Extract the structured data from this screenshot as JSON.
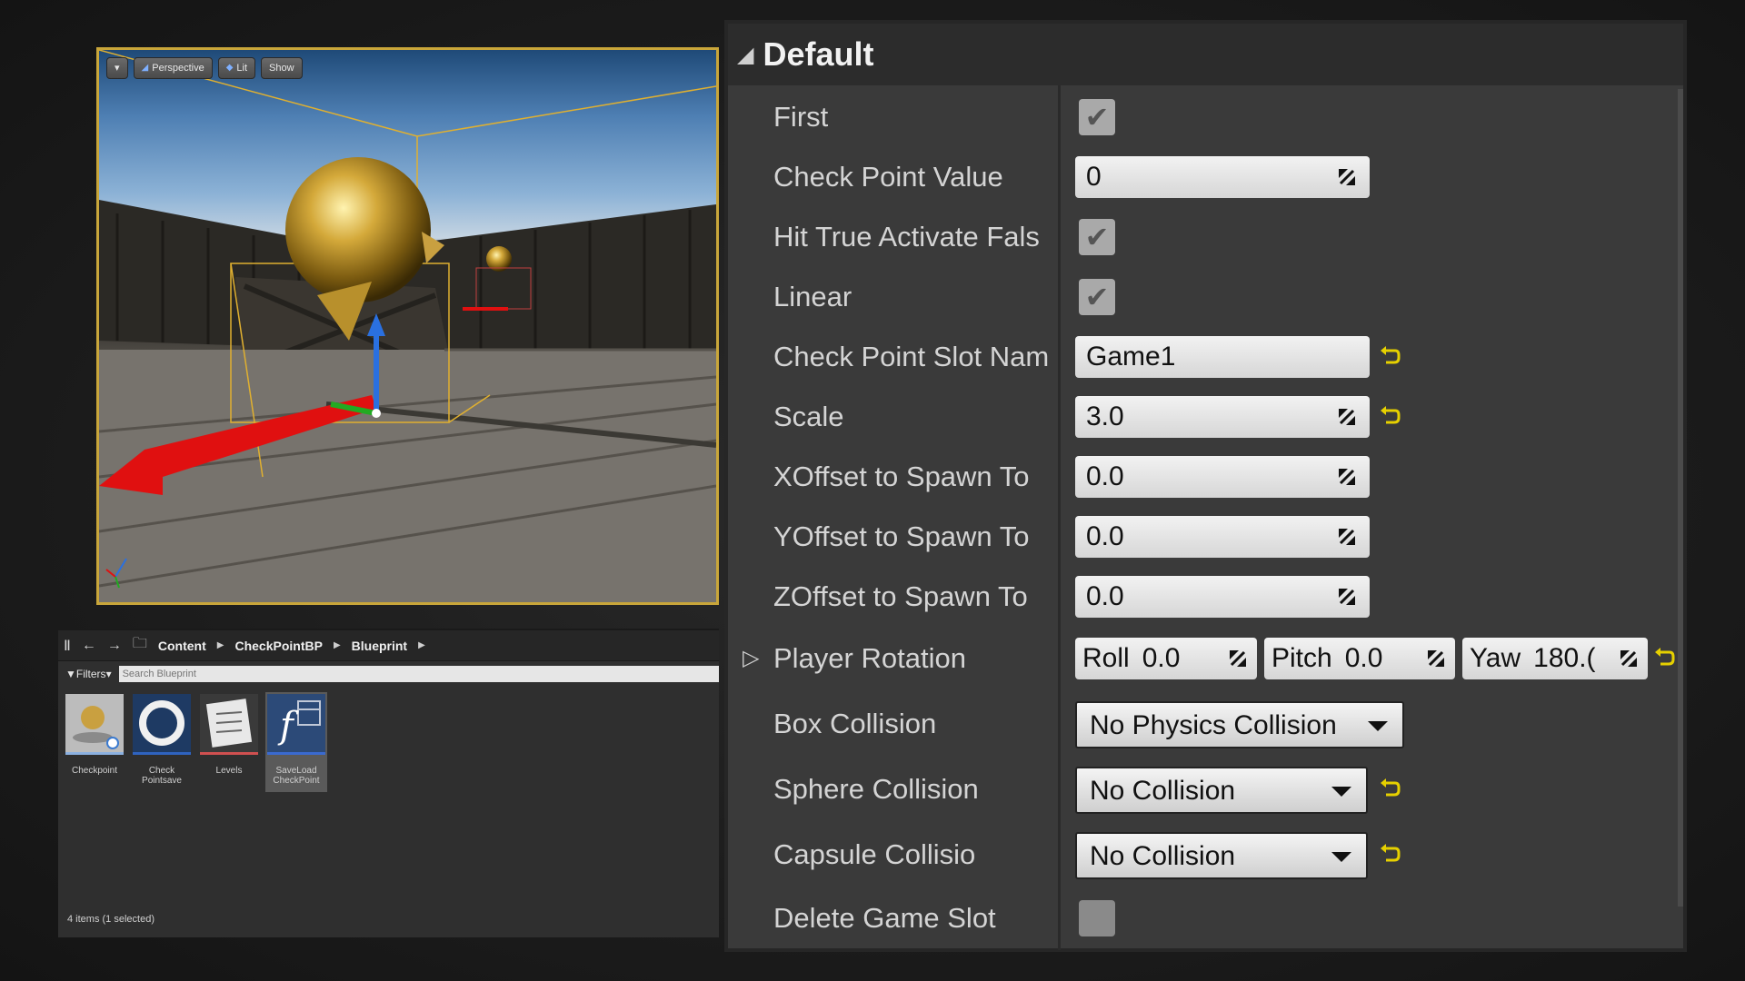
{
  "viewport": {
    "toolbar": {
      "menu_label": "▾",
      "perspective_label": "Perspective",
      "lit_label": "Lit",
      "show_label": "Show"
    }
  },
  "content_browser": {
    "breadcrumb": [
      "Content",
      "CheckPointBP",
      "Blueprint"
    ],
    "filters_label": "Filters",
    "search_placeholder": "Search Blueprint",
    "assets": [
      {
        "label": "Checkpoint",
        "icon": "sphere-mesh-icon"
      },
      {
        "label": "Check Pointsave",
        "icon": "ring-icon"
      },
      {
        "label": "Levels",
        "icon": "list-icon"
      },
      {
        "label": "SaveLoad CheckPoint",
        "icon": "function-icon",
        "selected": true
      }
    ],
    "status": "4 items (1 selected)"
  },
  "details": {
    "section_title": "Default",
    "rows": {
      "first": {
        "label": "First",
        "checked": true
      },
      "check_point_value": {
        "label": "Check Point Value",
        "value": "0"
      },
      "hit_true": {
        "label": "Hit True Activate Fals",
        "checked": true
      },
      "linear": {
        "label": "Linear",
        "checked": true
      },
      "slot_name": {
        "label": "Check Point Slot Nam",
        "value": "Game1"
      },
      "scale": {
        "label": "Scale",
        "value": "3.0"
      },
      "xoffset": {
        "label": "XOffset to Spawn To",
        "value": "0.0"
      },
      "yoffset": {
        "label": "YOffset to Spawn To",
        "value": "0.0"
      },
      "zoffset": {
        "label": "ZOffset to Spawn To",
        "value": "0.0"
      },
      "player_rotation": {
        "label": "Player Rotation",
        "roll_label": "Roll",
        "roll_value": "0.0",
        "pitch_label": "Pitch",
        "pitch_value": "0.0",
        "yaw_label": "Yaw",
        "yaw_value": "180.("
      },
      "box_collision": {
        "label": "Box Collision",
        "value": "No Physics Collision"
      },
      "sphere_collision": {
        "label": "Sphere Collision",
        "value": "No Collision"
      },
      "capsule_collision": {
        "label": "Capsule Collisio",
        "value": "No Collision"
      },
      "delete_game_slot": {
        "label": "Delete Game Slot",
        "checked": false
      }
    },
    "check_glyph": "✔"
  },
  "colors": {
    "selection_outline": "#c9a63a",
    "reset_arrow": "#e6d000",
    "gizmo_x": "#e01010",
    "gizmo_y": "#22aa22",
    "gizmo_z": "#2a70e0"
  }
}
